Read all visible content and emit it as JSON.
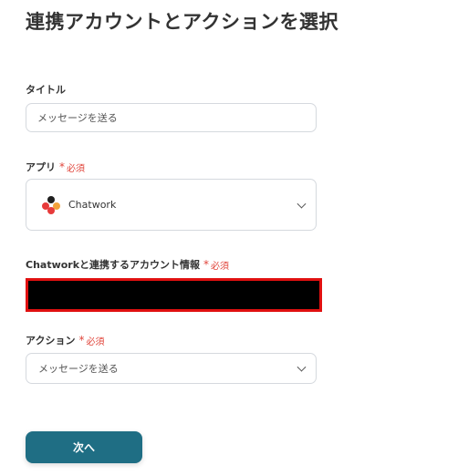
{
  "page": {
    "title": "連携アカウントとアクションを選択"
  },
  "title_field": {
    "label": "タイトル",
    "value": "メッセージを送る"
  },
  "app_field": {
    "label": "アプリ",
    "required_text": "必須",
    "selected_app": "Chatwork",
    "logo_colors": [
      "#e73b3b",
      "#f2a23a",
      "#1f1f1f",
      "#e73b3b"
    ]
  },
  "account_field": {
    "label": "Chatworkと連携するアカウント情報",
    "required_text": "必須"
  },
  "action_field": {
    "label": "アクション",
    "required_text": "必須",
    "selected": "メッセージを送る"
  },
  "footer": {
    "next_label": "次へ"
  },
  "colors": {
    "accent": "#1f6e84",
    "required": "#e0443a",
    "redaction_border": "#e01010"
  }
}
